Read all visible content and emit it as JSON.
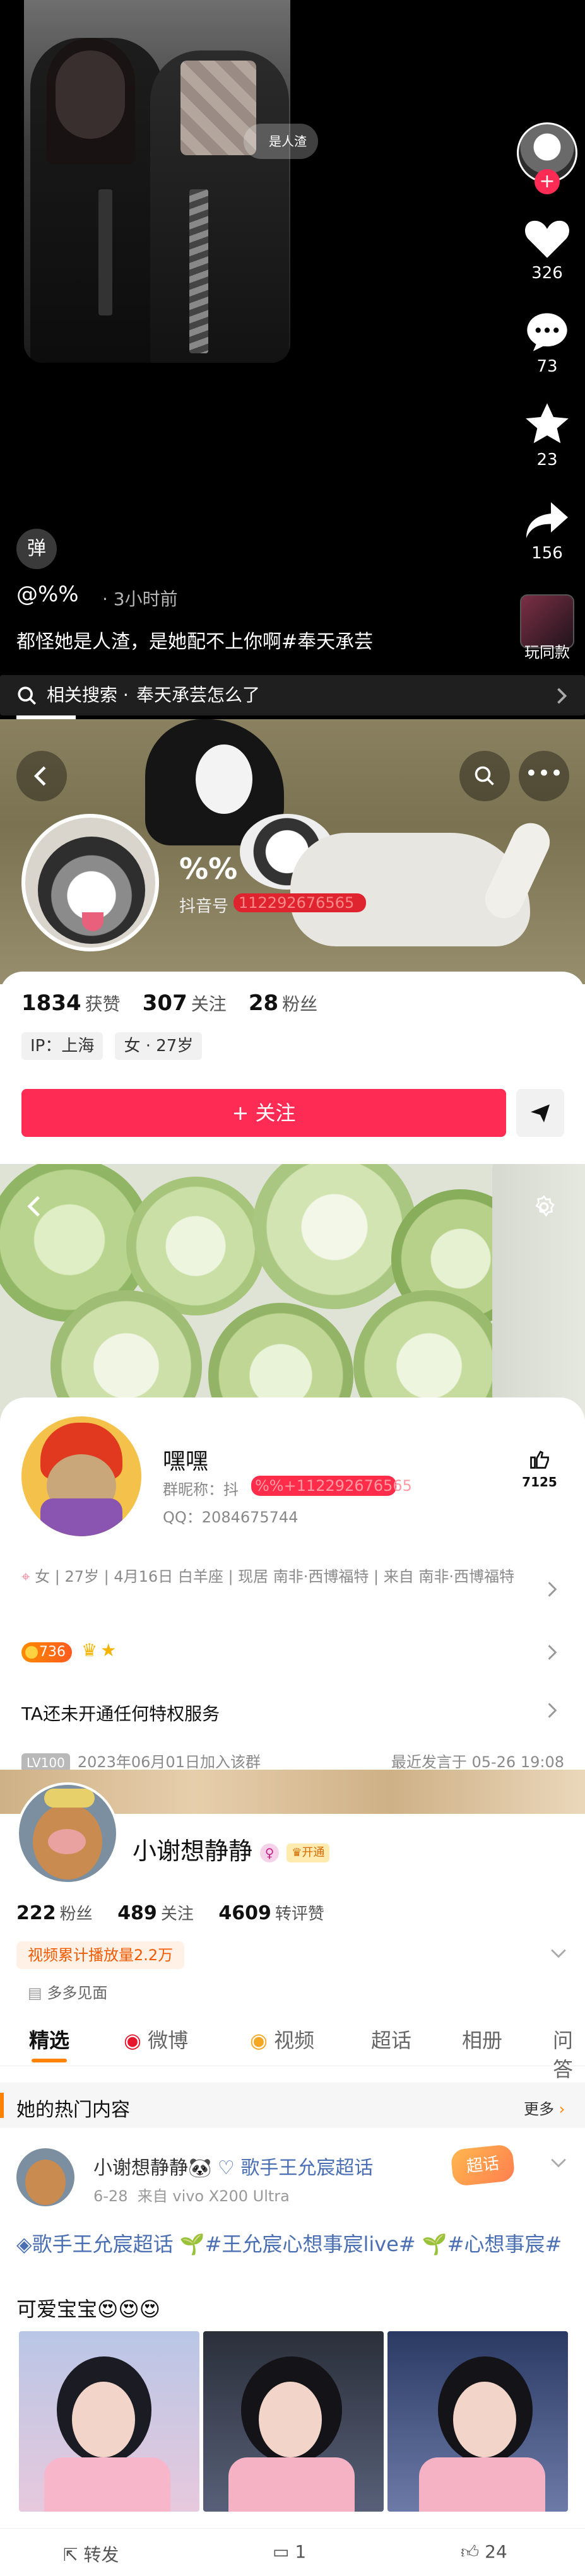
{
  "video": {
    "tag_text": "是人渣",
    "likes": "326",
    "comments": "73",
    "favorites": "23",
    "shares": "156",
    "music_label": "玩同款",
    "danmaku_glyph": "弹",
    "author": "@%%",
    "time": "· 3小时前",
    "caption": "都怪她是人渣，是她配不上你啊#奉天承芸",
    "related_prefix": "相关搜索 ·",
    "related_query": "奉天承芸怎么了"
  },
  "douyin": {
    "name": "%%",
    "id_prefix": "抖音号",
    "id_redacted": "112292676565",
    "likes_num": "1834",
    "likes_label": "获赞",
    "following_num": "307",
    "following_label": "关注",
    "fans_num": "28",
    "fans_label": "粉丝",
    "ip_chip": "IP：上海",
    "info_chip": "女 · 27岁",
    "follow_label": "+ 关注"
  },
  "qq": {
    "name": "嘿嘿",
    "group_nick_label": "群昵称：抖",
    "group_nick_redacted": "%%+112292676565",
    "qq_number": "QQ：2084675744",
    "like_count": "7125",
    "info_line": "女 | 27岁 | 4月16日 白羊座 | 现居 南非·西博福特 | 来自 南非·西博福特",
    "level_badge": "736",
    "service_text": "TA还未开通任何特权服务",
    "lv": "LV100",
    "joined": "2023年06月01日加入该群",
    "last_speak": "最近发言于 05-26 19:08"
  },
  "weibo": {
    "name": "小谢想静静",
    "vip_label": "开通",
    "fans_num": "222",
    "fans_label": "粉丝",
    "follow_num": "489",
    "follow_label": "关注",
    "likes_num": "4609",
    "likes_label": "转评赞",
    "video_play": "视频累计播放量2.2万",
    "visit": "多多见面",
    "tabs": [
      "精选",
      "微博",
      "视频",
      "超话",
      "相册",
      "问答"
    ],
    "hot_title": "她的热门内容",
    "more": "更多",
    "post_author": "小谢想静静🐼",
    "post_super": "歌手王允宸超话",
    "post_date": "6-28",
    "post_source": "来自 vivo X200 Ultra",
    "post_stamp": "超话",
    "post_line1": "歌手王允宸超话 🌱#王允宸心想事宸live# 🌱#心想事宸#",
    "post_line2": "可爱宝宝😍😍😍",
    "repost_label": "转发",
    "comment_count": "1",
    "like_count": "24"
  },
  "colors": {
    "douyin_red": "#fe2c55",
    "weibo_orange": "#f05a00",
    "topic_blue": "#4a6fb3"
  }
}
